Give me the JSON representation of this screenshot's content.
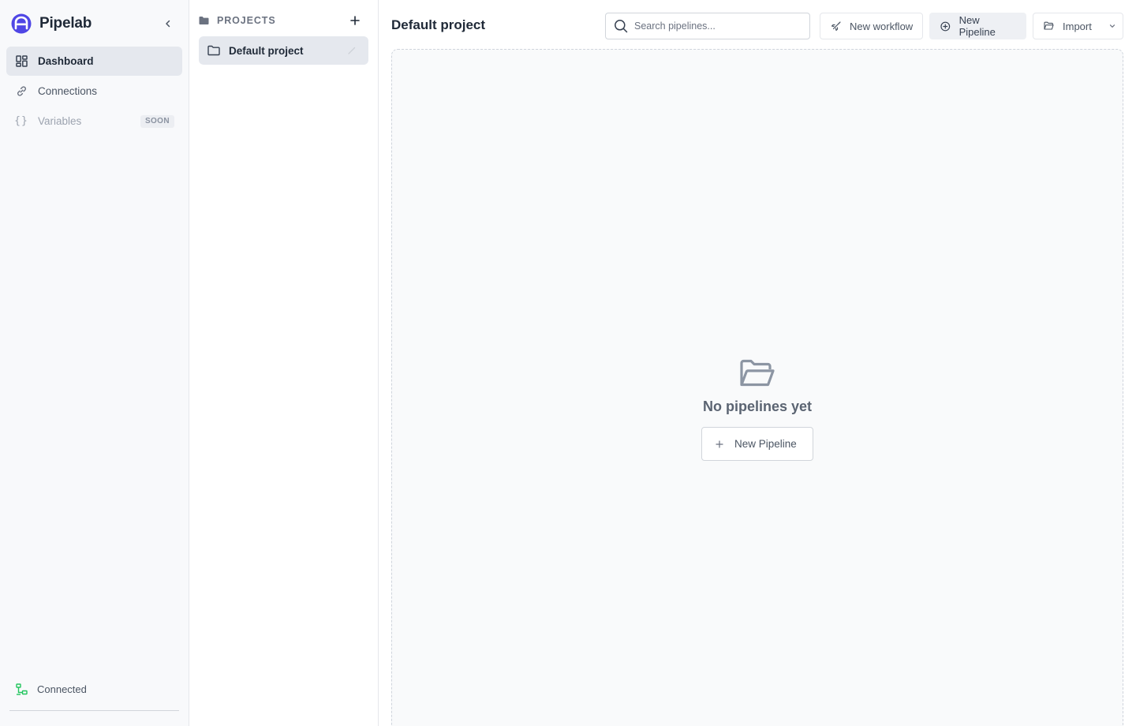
{
  "app": {
    "name": "Pipelab",
    "brand_color": "#4f46e5"
  },
  "sidebar": {
    "items": [
      {
        "label": "Dashboard",
        "icon": "dashboard-icon",
        "active": true
      },
      {
        "label": "Connections",
        "icon": "link-icon",
        "active": false
      },
      {
        "label": "Variables",
        "icon": "braces-icon",
        "active": false,
        "disabled": true,
        "badge": "SOON"
      }
    ],
    "status": {
      "label": "Connected",
      "icon": "network-icon",
      "color": "#22c55e"
    }
  },
  "projects": {
    "title": "PROJECTS",
    "items": [
      {
        "label": "Default project",
        "selected": true
      }
    ]
  },
  "main": {
    "title": "Default project",
    "search": {
      "placeholder": "Search pipelines..."
    },
    "toolbar": {
      "new_workflow": "New workflow",
      "new_pipeline": "New Pipeline",
      "import": "Import"
    },
    "empty_state": {
      "icon": "folder-open-icon",
      "title": "No pipelines yet",
      "button": "New Pipeline"
    }
  }
}
